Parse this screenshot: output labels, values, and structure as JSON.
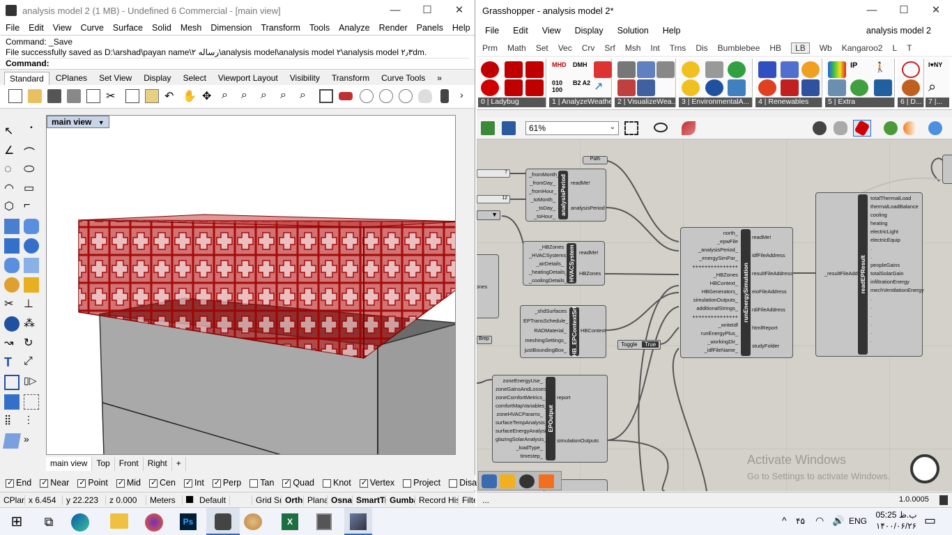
{
  "rhino": {
    "title": "analysis model 2 (1 MB) - Undefined 6 Commercial - [main view]",
    "menu": [
      "File",
      "Edit",
      "View",
      "Curve",
      "Surface",
      "Solid",
      "Mesh",
      "Dimension",
      "Transform",
      "Tools",
      "Analyze",
      "Render",
      "Panels",
      "Help"
    ],
    "cmd_line1": "Command: _Save",
    "cmd_line2": "File successfully saved as D:\\arshad\\payan name\\رساله ۲\\analysis model\\analysis model ۲\\analysis model ۲٫۳dm.",
    "cmd_prompt": "Command:",
    "toolbar_tabs": [
      "Standard",
      "CPlanes",
      "Set View",
      "Display",
      "Select",
      "Viewport Layout",
      "Visibility",
      "Transform",
      "Curve Tools"
    ],
    "viewport_title": "main view",
    "view_tabs": [
      "main view",
      "Top",
      "Front",
      "Right"
    ],
    "osnaps": [
      {
        "label": "End",
        "on": true
      },
      {
        "label": "Near",
        "on": true
      },
      {
        "label": "Point",
        "on": true
      },
      {
        "label": "Mid",
        "on": true
      },
      {
        "label": "Cen",
        "on": true
      },
      {
        "label": "Int",
        "on": true
      },
      {
        "label": "Perp",
        "on": true
      },
      {
        "label": "Tan",
        "on": false
      },
      {
        "label": "Quad",
        "on": true
      },
      {
        "label": "Knot",
        "on": false
      },
      {
        "label": "Vertex",
        "on": true
      },
      {
        "label": "Project",
        "on": false
      },
      {
        "label": "Disable",
        "on": false
      }
    ],
    "status": {
      "cplane": "CPlan",
      "x": "x 6.454",
      "y": "y 22.223",
      "z": "z 0.000",
      "units": "Meters",
      "layer": "Default",
      "grid": "Grid Sn",
      "ortho": "Ortho",
      "planar": "Plana",
      "osnap": "Osnap",
      "smarttrack": "SmartTr",
      "gumball": "Gumba",
      "record": "Record His",
      "filter": "Filte"
    }
  },
  "grasshopper": {
    "title": "Grasshopper - analysis model 2*",
    "menu": [
      "File",
      "Edit",
      "View",
      "Display",
      "Solution",
      "Help"
    ],
    "doc_name": "analysis model 2",
    "tabs": [
      "Prm",
      "Math",
      "Set",
      "Vec",
      "Crv",
      "Srf",
      "Msh",
      "Int",
      "Trns",
      "Dis",
      "Bumblebee",
      "HB",
      "LB",
      "Wb",
      "Kangaroo2",
      "L",
      "T"
    ],
    "active_tab": "LB",
    "groups": [
      "0 | Ladybug",
      "1 | AnalyzeWeathe...",
      "2 | VisualizeWea...",
      "3 | EnvironmentalA...",
      "4 | Renewables",
      "5 | Extra",
      "6 | D...",
      "7 |..."
    ],
    "zoom": "61%",
    "components": {
      "analysisPeriod": {
        "name": "analysisPeriod",
        "inputs": [
          "_fromMonth_",
          "_fromDay_",
          "_fromHour_",
          "_toMonth_",
          "_toDay_",
          "_toHour_"
        ],
        "outputs": [
          "readMe!",
          "analysisPeriod"
        ]
      },
      "HBSystem": {
        "name": "HVACSystem",
        "inputs": [
          "_HBZones",
          "_HVACSystems",
          "_airDetails_",
          "_heatingDetails_",
          "_coolingDetails_"
        ],
        "outputs": [
          "readMe!",
          "HBZones"
        ]
      },
      "context": {
        "name": "HB_EPContextSrf",
        "inputs": [
          "_shdSurfaces",
          "EPTransSchedule_",
          "RADMaterial_",
          "meshingSettings_",
          "justBoundingBox_"
        ],
        "outputs": [
          "HBContext"
        ]
      },
      "runEnergy": {
        "name": "runEnergySimulation",
        "inputs": [
          "north_",
          "_epwFile",
          "_analysisPeriod_",
          "_energySimPar_",
          "+++++++++++++++",
          "_HBZones",
          "HBContext_",
          "HBGenerators_",
          "simulationOutputs_",
          "additionalStrings_",
          "+++++++++++++++",
          "_writeIdf",
          "runEnergyPlus_",
          "_workingDir_",
          "_idfFileName_"
        ],
        "outputs": [
          "readMe!",
          "idfFileAddress",
          "resultFileAddress",
          "eioFileAddress",
          "rdiFileAddress",
          "htmlReport",
          "studyFolder"
        ]
      },
      "readEP": {
        "name": "readEPResult",
        "inputs": [
          "_resultFileAddress"
        ],
        "outputs": [
          "totalThermalLoad",
          "thermalLoadBalance",
          "cooling",
          "heating",
          "electricLight",
          "electricEquip",
          ".",
          ".",
          "peopleGains",
          "totalSolarGain",
          "infiltrationEnergy",
          "mechVentilationEnergy",
          ".",
          ".",
          ".",
          ".",
          ".",
          "."
        ]
      },
      "epOutput": {
        "name": "EPOutput",
        "inputs": [
          "zoneEnergyUse_",
          "zoneGainsAndLosses_",
          "zoneComfortMetrics_",
          "comfortMapVariables_",
          "zoneHVACParams_",
          "surfaceTempAnalysis_",
          "surfaceEnergyAnalysis_",
          "glazingSolarAnalysis_",
          "_loadType_",
          "timestep_"
        ],
        "outputs": [
          "report",
          "simulationOutputs"
        ]
      }
    },
    "slider1": "7",
    "slider2": "12",
    "path_label": "Path",
    "toggle_label": "Toggle",
    "toggle_value": "True",
    "brep_label": "Brep",
    "zones_label": "ones",
    "status_left": "...",
    "status_right": "1.0.0005",
    "watermark1": "Activate Windows",
    "watermark2": "Go to Settings to activate Windows."
  },
  "taskbar": {
    "time": "05:25 ب.ظ",
    "date": "۱۴۰۰/۰۶/۲۶",
    "lang": "ENG",
    "tray_num": "۴۵"
  },
  "colors": {
    "model_red": "#b00000",
    "canvas": "#d3d1c9",
    "component": "#c6c6c6"
  }
}
